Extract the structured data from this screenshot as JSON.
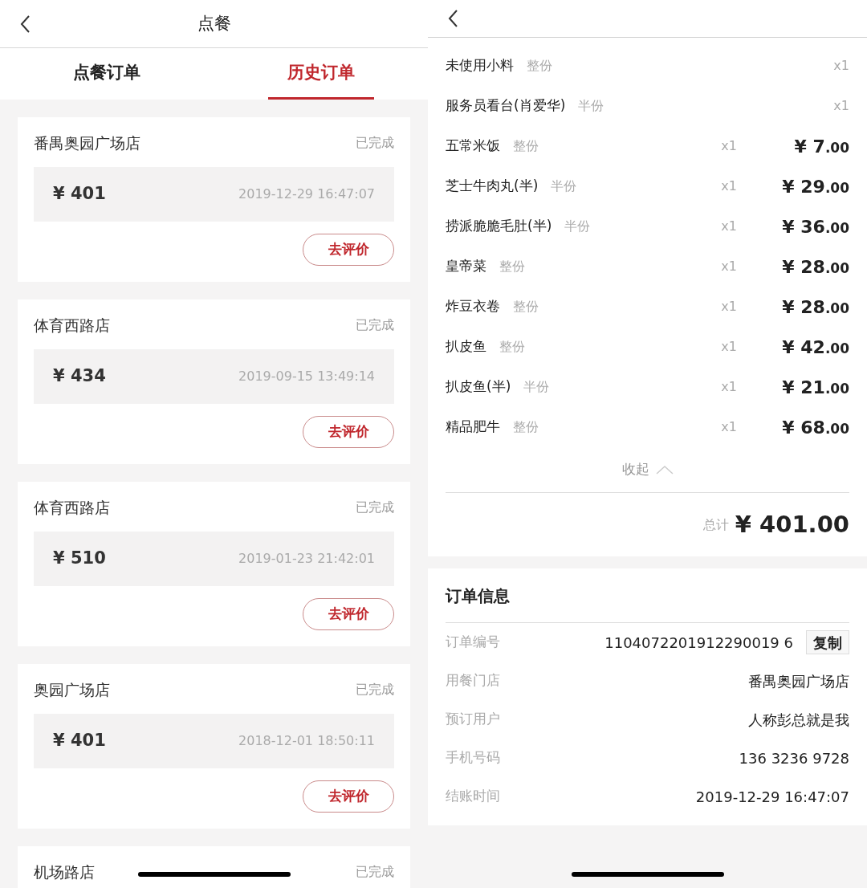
{
  "left": {
    "header": {
      "title": "点餐"
    },
    "tabs": [
      {
        "label": "点餐订单",
        "selected": false
      },
      {
        "label": "历史订单",
        "selected": true
      }
    ],
    "orders": [
      {
        "store": "番禺奥园广场店",
        "status": "已完成",
        "amount": "¥ 401",
        "time": "2019-12-29 16:47:07",
        "action": "去评价"
      },
      {
        "store": "体育西路店",
        "status": "已完成",
        "amount": "¥ 434",
        "time": "2019-09-15 13:49:14",
        "action": "去评价"
      },
      {
        "store": "体育西路店",
        "status": "已完成",
        "amount": "¥ 510",
        "time": "2019-01-23 21:42:01",
        "action": "去评价"
      },
      {
        "store": "奥园广场店",
        "status": "已完成",
        "amount": "¥ 401",
        "time": "2018-12-01 18:50:11",
        "action": "去评价"
      },
      {
        "store": "机场路店",
        "status": "已完成"
      }
    ]
  },
  "right": {
    "items": [
      {
        "name": "未使用小料",
        "portion": "整份",
        "qty": "x1"
      },
      {
        "name": "服务员看台(肖爱华)",
        "portion": "半份",
        "qty": "x1"
      },
      {
        "name": "五常米饭",
        "portion": "整份",
        "qty": "x1",
        "price": "¥ 7.00"
      },
      {
        "name": "芝士牛肉丸(半)",
        "portion": "半份",
        "qty": "x1",
        "price": "¥ 29.00"
      },
      {
        "name": "捞派脆脆毛肚(半)",
        "portion": "半份",
        "qty": "x1",
        "price": "¥ 36.00"
      },
      {
        "name": "皇帝菜",
        "portion": "整份",
        "qty": "x1",
        "price": "¥ 28.00"
      },
      {
        "name": "炸豆衣卷",
        "portion": "整份",
        "qty": "x1",
        "price": "¥ 28.00"
      },
      {
        "name": "扒皮鱼",
        "portion": "整份",
        "qty": "x1",
        "price": "¥ 42.00"
      },
      {
        "name": "扒皮鱼(半)",
        "portion": "半份",
        "qty": "x1",
        "price": "¥ 21.00"
      },
      {
        "name": "精品肥牛",
        "portion": "整份",
        "qty": "x1",
        "price": "¥ 68.00"
      }
    ],
    "collapse": "收起",
    "total": {
      "label": "总计",
      "amount": "¥ 401.00"
    },
    "info": {
      "title": "订单信息",
      "copy": "复制",
      "rows": [
        {
          "label": "订单编号",
          "value": "1104072201912290019 6"
        },
        {
          "label": "用餐门店",
          "value": "番禺奥园广场店"
        },
        {
          "label": "预订用户",
          "value": "人称彭总就是我"
        },
        {
          "label": "手机号码",
          "value": "136 3236 9728"
        },
        {
          "label": "结账时间",
          "value": "2019-12-29 16:47:07"
        }
      ]
    }
  }
}
